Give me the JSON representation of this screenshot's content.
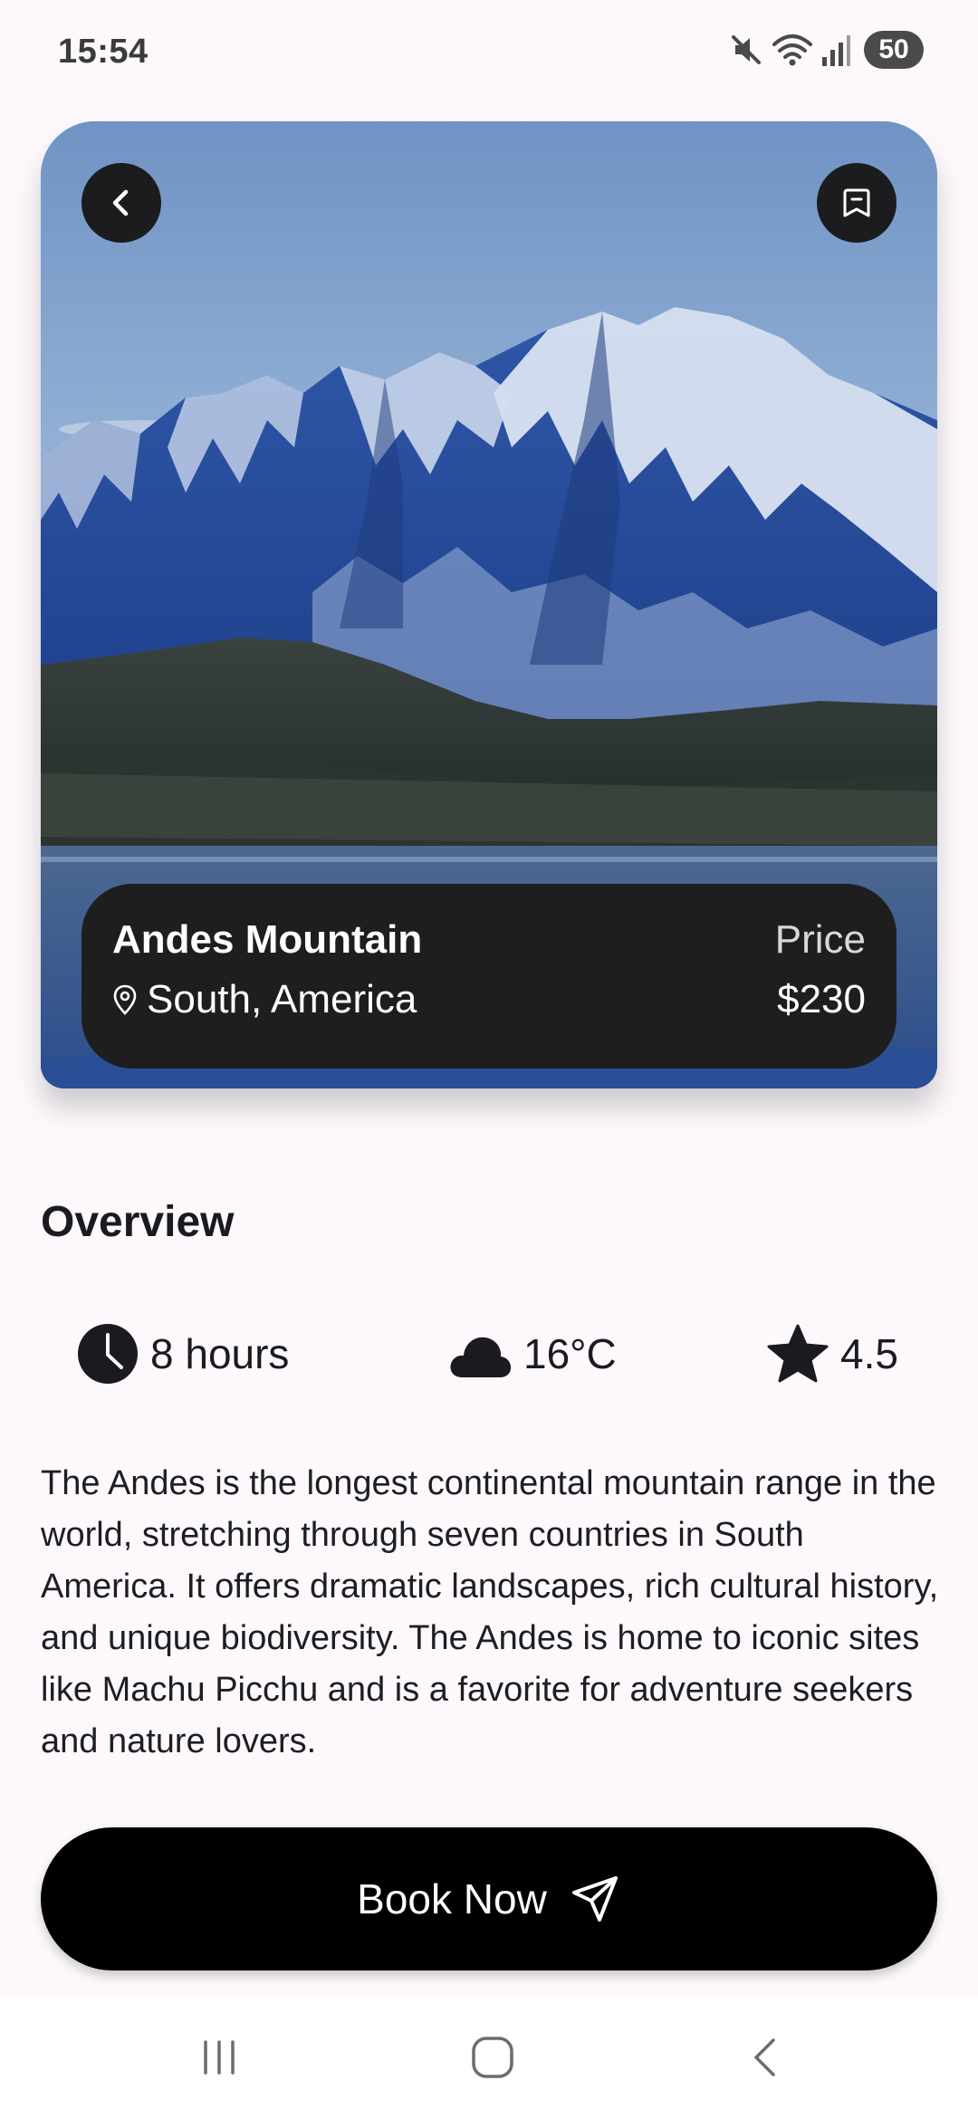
{
  "status_bar": {
    "time": "15:54",
    "battery": "50",
    "icons": [
      "mute-icon",
      "wifi-icon",
      "signal-icon",
      "battery-icon"
    ]
  },
  "hero": {
    "image": "mountain-landscape-image",
    "place_name": "Andes Mountain",
    "location": "South, America",
    "price_label": "Price",
    "price": "$230"
  },
  "overview": {
    "title": "Overview",
    "stats": {
      "duration": "8 hours",
      "temperature": "16°C",
      "rating": "4.5"
    },
    "description": "The Andes is the longest continental mountain range in the world, stretching through seven countries in South America. It offers dramatic landscapes, rich cultural history, and unique biodiversity. The Andes is home to iconic sites like Machu Picchu and is a favorite for adventure seekers and nature lovers."
  },
  "actions": {
    "book_label": "Book Now"
  },
  "colors": {
    "background": "#fcf8fc",
    "panel": "#1e1e1e",
    "button": "#000000",
    "text": "#1b1b1f"
  }
}
